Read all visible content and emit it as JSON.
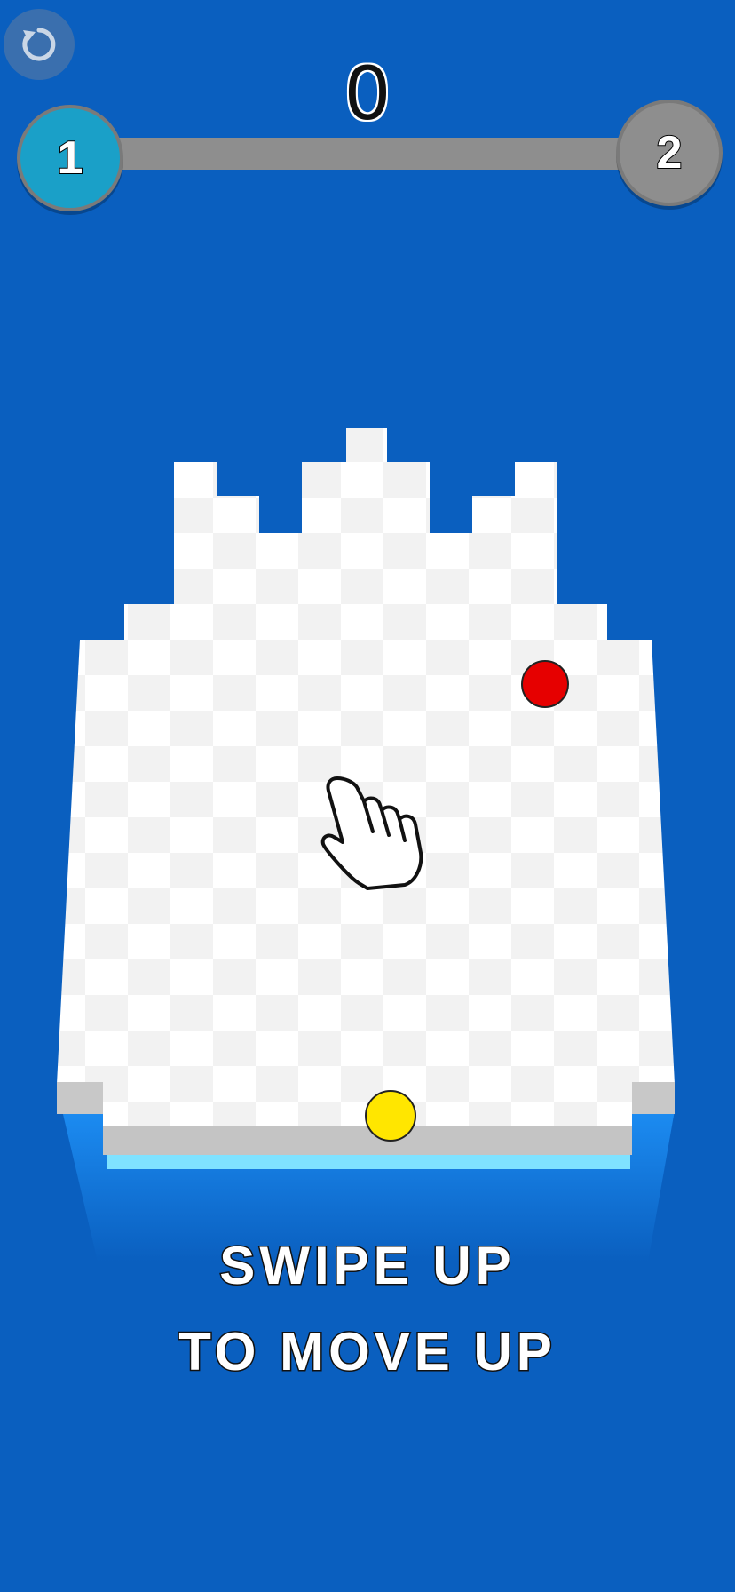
{
  "hud": {
    "score": "0",
    "current_level": "1",
    "next_level": "2",
    "restart_icon": "restart-icon"
  },
  "tutorial": {
    "line1": "SWIPE UP",
    "line2": "TO MOVE UP",
    "hand_icon": "hand-pointer-icon"
  },
  "colors": {
    "background": "#0a5fbf",
    "player_ball": "#ffe600",
    "target_ball": "#e60000",
    "water": "#1e88f0",
    "level_current": "#1aa0c8",
    "level_next": "#8e8e8e"
  }
}
